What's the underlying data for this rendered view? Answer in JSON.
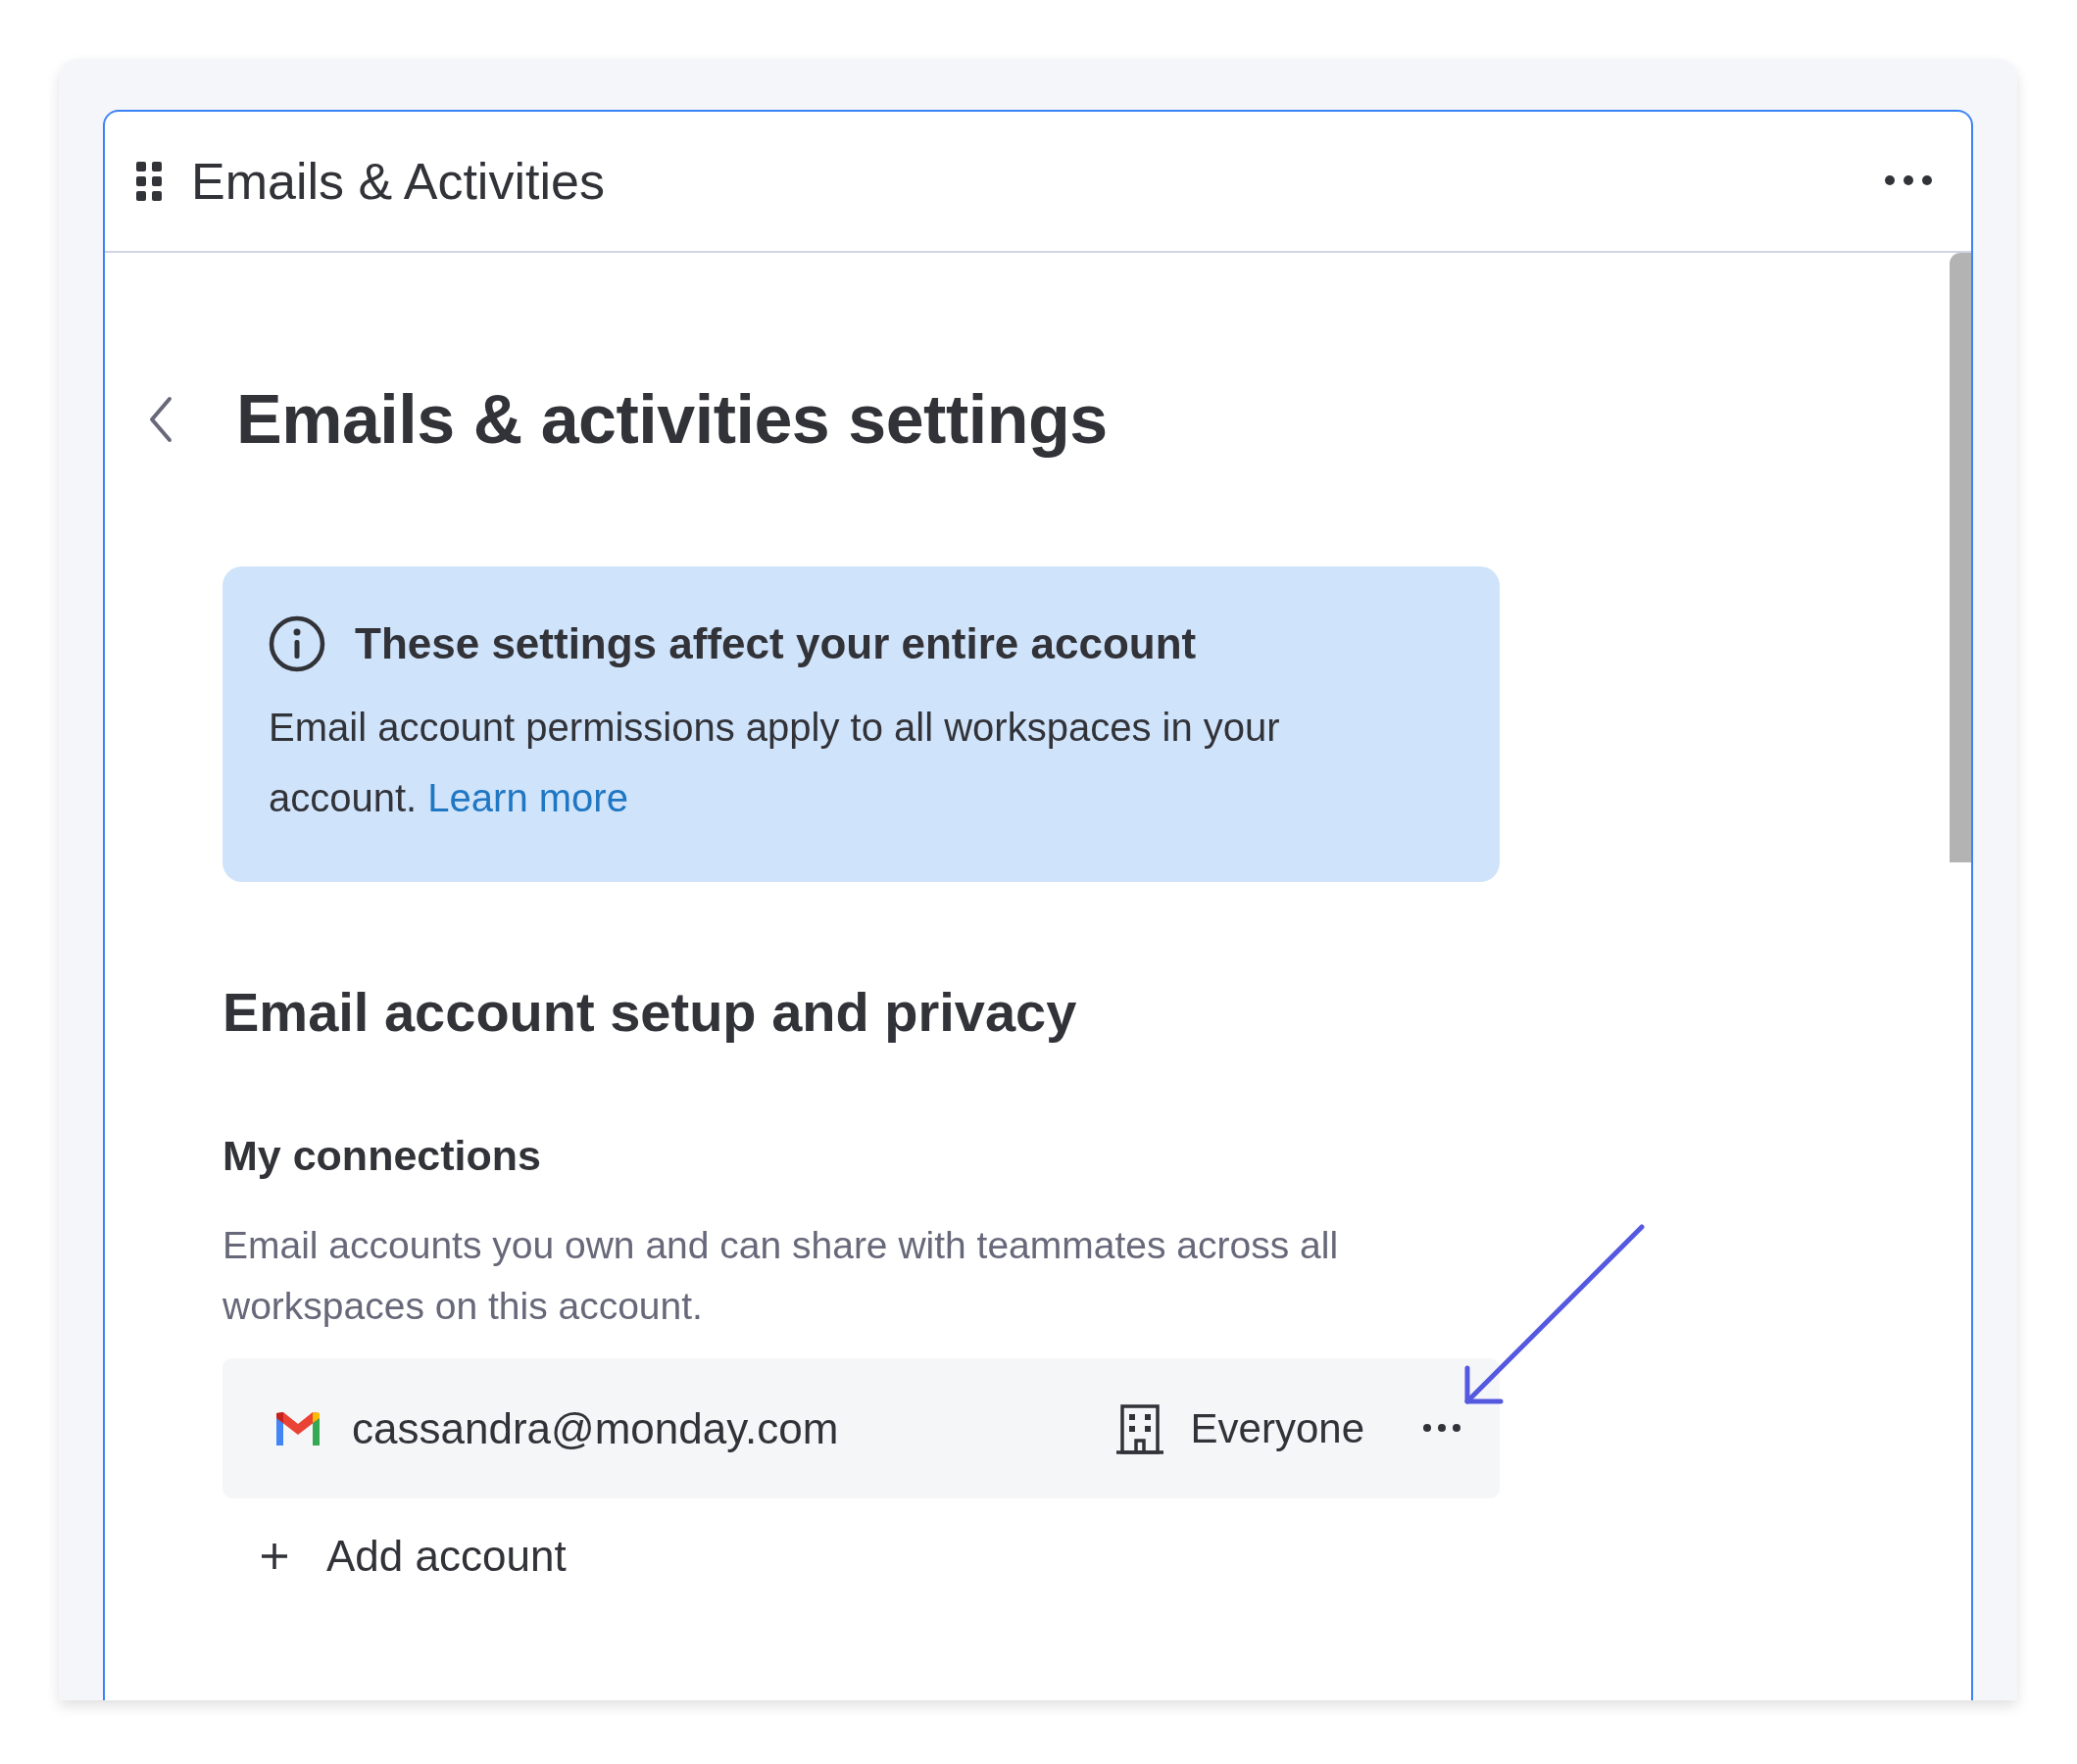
{
  "panel": {
    "title": "Emails & Activities"
  },
  "page": {
    "title": "Emails & activities settings"
  },
  "notice": {
    "title": "These settings affect your entire account",
    "body": "Email account permissions apply to all workspaces in your account.",
    "link": "Learn more"
  },
  "section": {
    "title": "Email account setup and privacy"
  },
  "connections_group": {
    "title": "My connections",
    "description": "Email accounts you own and can share with teammates across all workspaces on this account."
  },
  "connections": [
    {
      "email": "cassandra@monday.com",
      "sharing": "Everyone"
    }
  ],
  "add_button": {
    "label": "Add account"
  }
}
